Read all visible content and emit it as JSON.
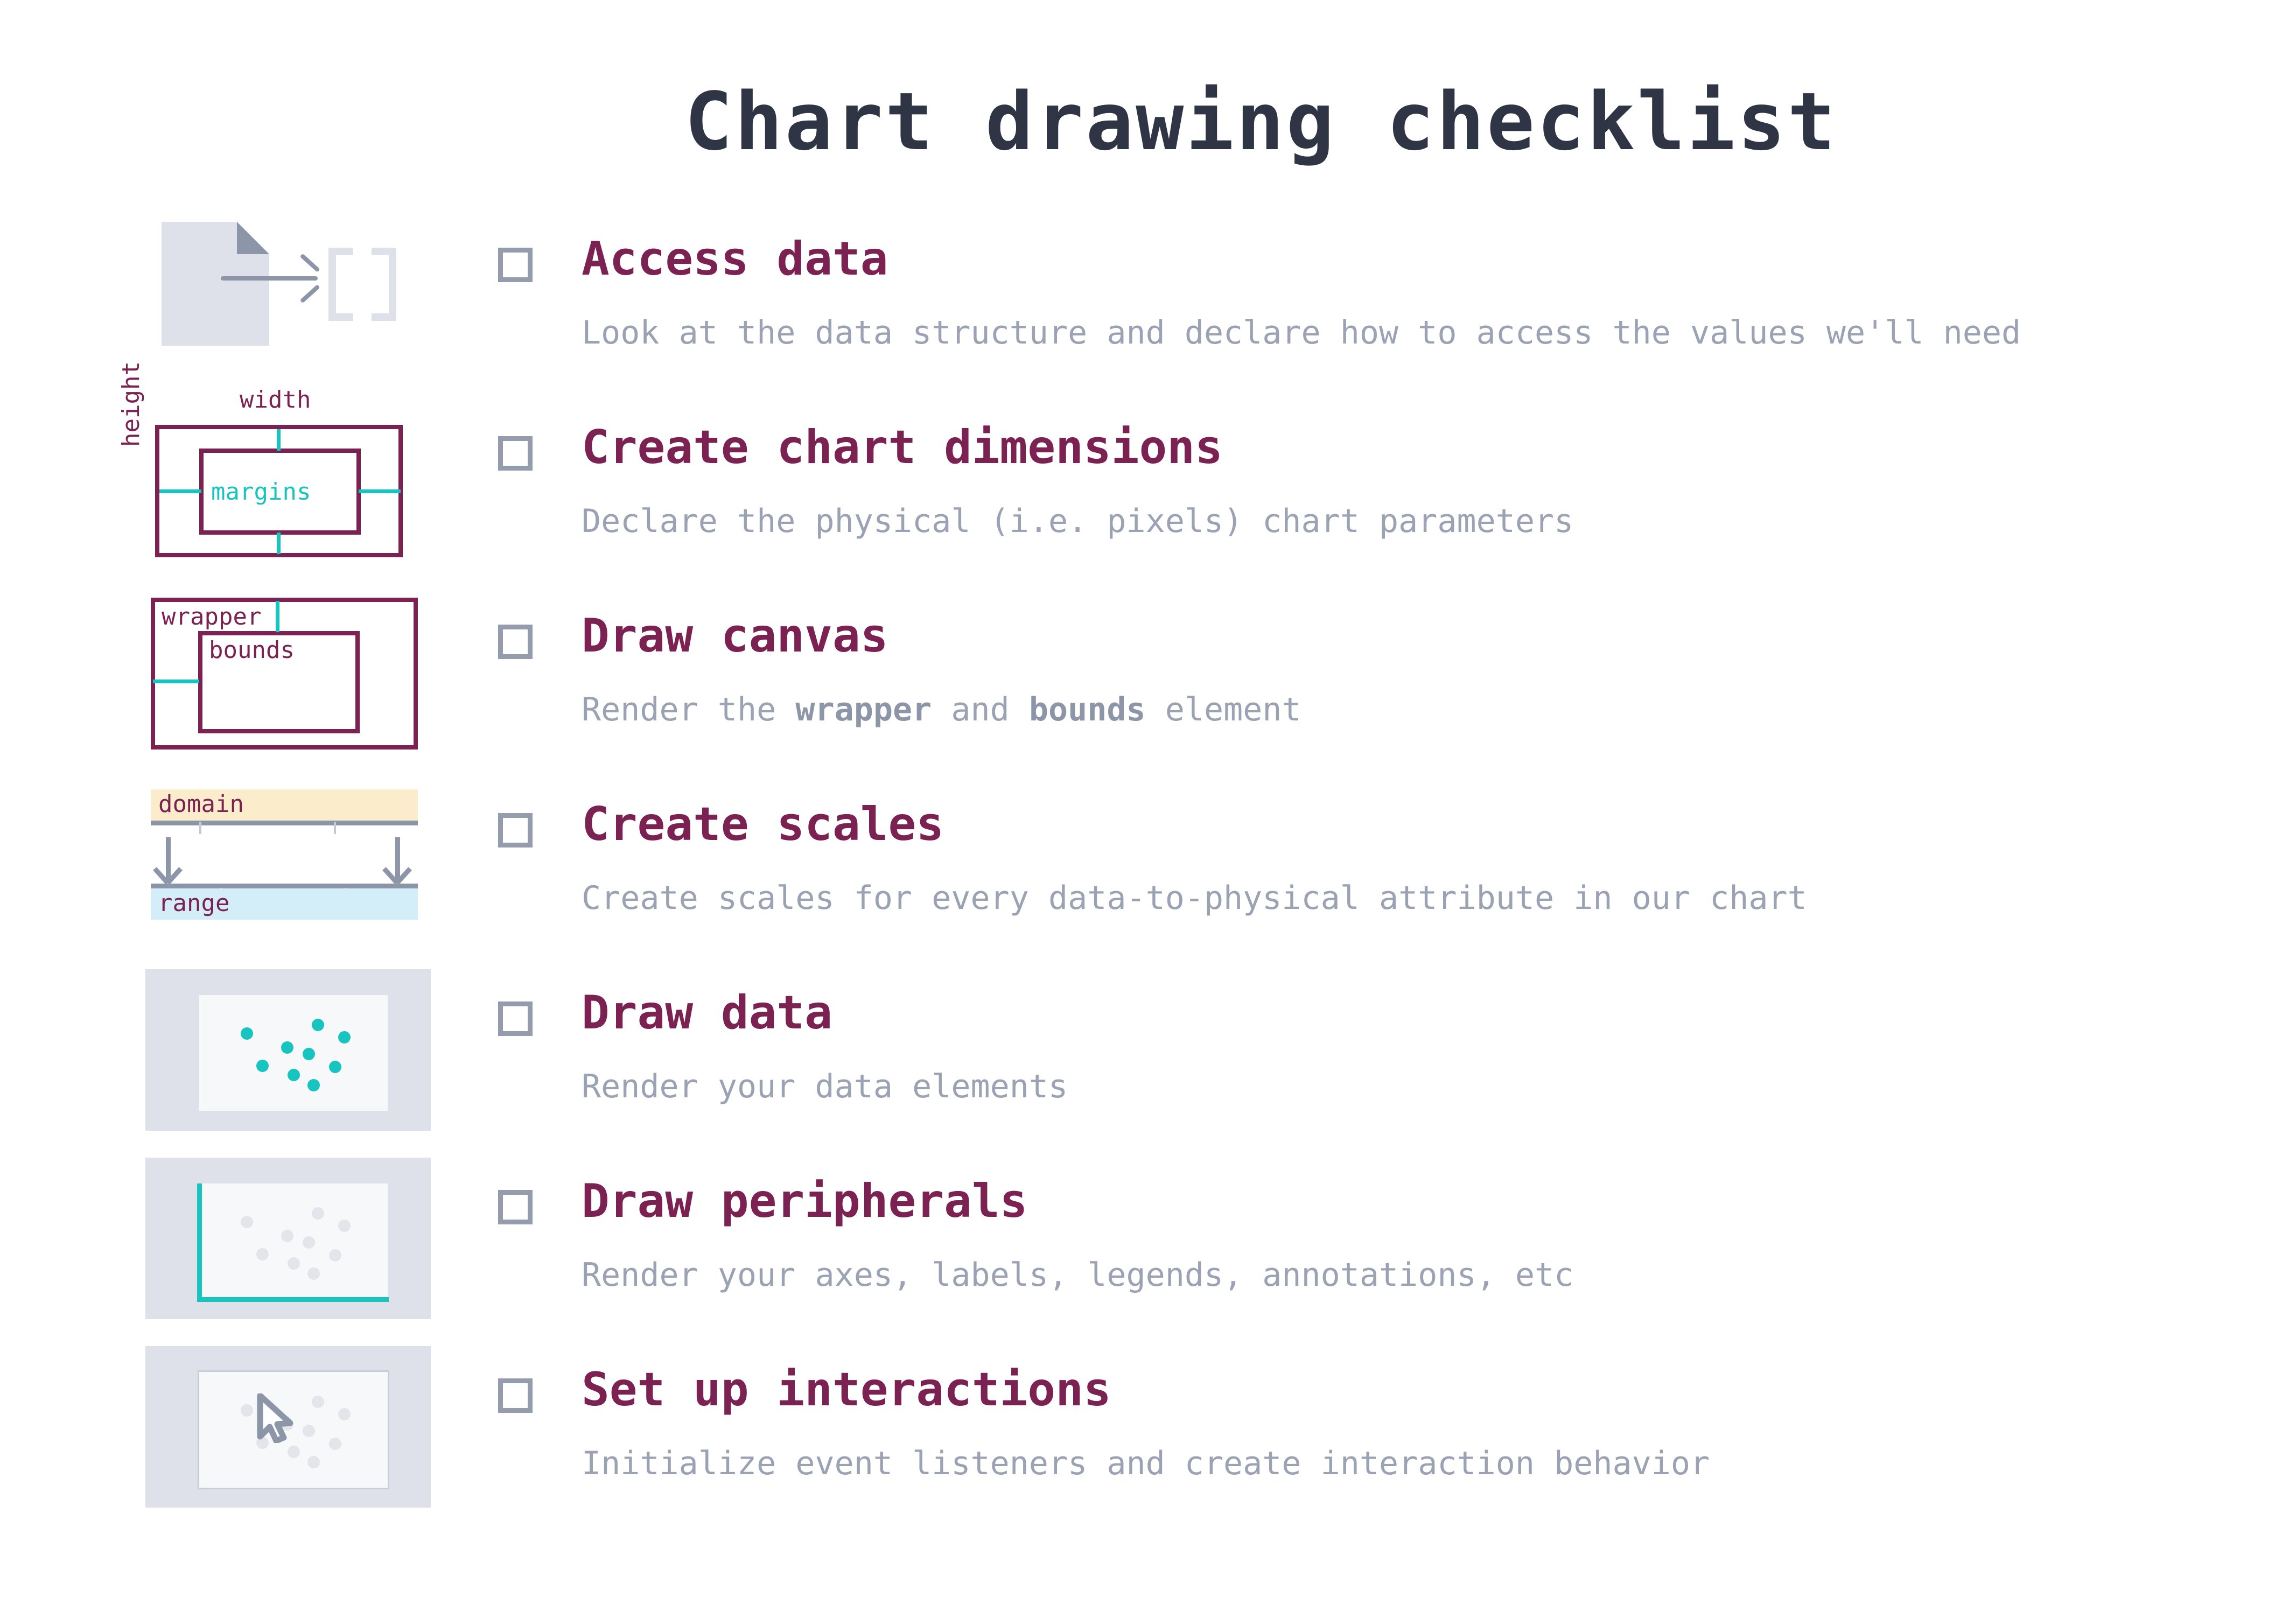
{
  "page": {
    "title": "Chart drawing checklist",
    "background": "#ffffff"
  },
  "colors": {
    "title": "#2f3545",
    "heading": "#7b2252",
    "body": "#9aa2b4",
    "checkbox_border": "#949cae",
    "teal": "#18c4bf",
    "panel": "#dee1ea",
    "panel_inner": "#f7f8f9",
    "dot_grey": "#e3e5ea",
    "axis_grey": "#8d95a8",
    "domain_band": "#fbeccc",
    "range_band": "#d3eef8"
  },
  "items": [
    {
      "id": "access-data",
      "checked": false,
      "title": "Access data",
      "desc": "Look at the data structure and declare how to access the values we'll need",
      "icon": "data-file-to-array-icon"
    },
    {
      "id": "create-chart-dimensions",
      "checked": false,
      "title": "Create chart dimensions",
      "desc": "Declare the physical (i.e. pixels) chart parameters",
      "icon": "chart-dimensions-icon",
      "labels": {
        "width": "width",
        "height": "height",
        "margins": "margins"
      }
    },
    {
      "id": "draw-canvas",
      "checked": false,
      "title": "Draw canvas",
      "desc_parts": [
        {
          "text": "Render the ",
          "bold": false
        },
        {
          "text": "wrapper",
          "bold": true
        },
        {
          "text": " and ",
          "bold": false
        },
        {
          "text": "bounds",
          "bold": true
        },
        {
          "text": " element",
          "bold": false
        }
      ],
      "icon": "wrapper-bounds-icon",
      "labels": {
        "wrapper": "wrapper",
        "bounds": "bounds"
      }
    },
    {
      "id": "create-scales",
      "checked": false,
      "title": "Create scales",
      "desc": "Create scales for every data-to-physical attribute in our chart",
      "icon": "domain-range-scale-icon",
      "labels": {
        "domain": "domain",
        "range": "range"
      }
    },
    {
      "id": "draw-data",
      "checked": false,
      "title": "Draw data",
      "desc": "Render your data elements",
      "icon": "scatter-dots-icon"
    },
    {
      "id": "draw-peripherals",
      "checked": false,
      "title": "Draw peripherals",
      "desc": "Render your axes, labels, legends, annotations, etc",
      "icon": "scatter-axes-icon"
    },
    {
      "id": "set-up-interactions",
      "checked": false,
      "title": "Set up interactions",
      "desc": "Initialize event listeners and create interaction behavior",
      "icon": "scatter-cursor-icon"
    }
  ],
  "chart_data": {
    "type": "scatter",
    "title": "",
    "xlabel": "",
    "ylabel": "",
    "note": "Decorative scatter thumbnails repeated in the Draw data / Draw peripherals / Set up interactions icons",
    "points": [
      {
        "x": 0.2,
        "y": 0.72
      },
      {
        "x": 0.66,
        "y": 0.82
      },
      {
        "x": 0.83,
        "y": 0.68
      },
      {
        "x": 0.46,
        "y": 0.56
      },
      {
        "x": 0.6,
        "y": 0.49
      },
      {
        "x": 0.3,
        "y": 0.35
      },
      {
        "x": 0.77,
        "y": 0.34
      },
      {
        "x": 0.5,
        "y": 0.25
      },
      {
        "x": 0.63,
        "y": 0.13
      }
    ],
    "xlim": [
      0,
      1
    ],
    "ylim": [
      0,
      1
    ],
    "grid": false,
    "legend": false
  }
}
